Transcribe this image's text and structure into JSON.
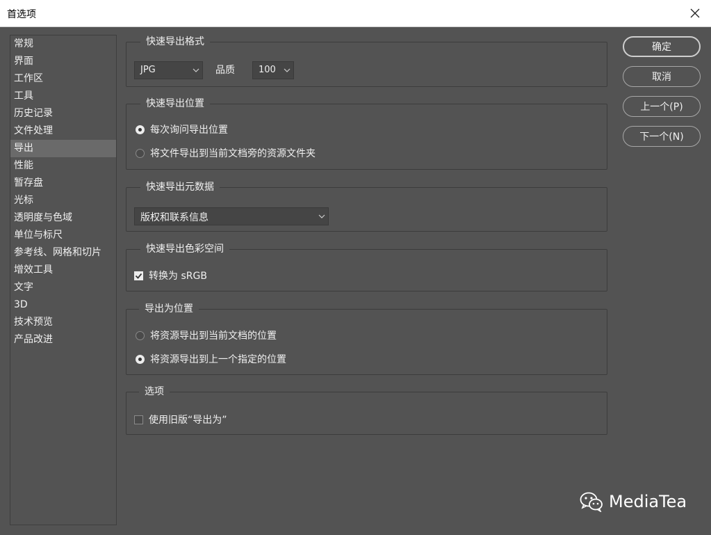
{
  "window": {
    "title": "首选项"
  },
  "sidebar": {
    "items": [
      {
        "label": "常规"
      },
      {
        "label": "界面"
      },
      {
        "label": "工作区"
      },
      {
        "label": "工具"
      },
      {
        "label": "历史记录"
      },
      {
        "label": "文件处理"
      },
      {
        "label": "导出",
        "selected": true
      },
      {
        "label": "性能"
      },
      {
        "label": "暂存盘"
      },
      {
        "label": "光标"
      },
      {
        "label": "透明度与色域"
      },
      {
        "label": "单位与标尺"
      },
      {
        "label": "参考线、网格和切片"
      },
      {
        "label": "增效工具"
      },
      {
        "label": "文字"
      },
      {
        "label": "3D"
      },
      {
        "label": "技术预览"
      },
      {
        "label": "产品改进"
      }
    ]
  },
  "quick_export_format": {
    "title": "快速导出格式",
    "format_value": "JPG",
    "quality_label": "品质",
    "quality_value": "100"
  },
  "quick_export_location": {
    "title": "快速导出位置",
    "options": [
      {
        "label": "每次询问导出位置",
        "checked": true
      },
      {
        "label": "将文件导出到当前文档旁的资源文件夹",
        "checked": false
      }
    ]
  },
  "quick_export_metadata": {
    "title": "快速导出元数据",
    "value": "版权和联系信息"
  },
  "quick_export_colorspace": {
    "title": "快速导出色彩空间",
    "checkbox_label": "转换为 sRGB",
    "checked": true
  },
  "export_as_location": {
    "title": "导出为位置",
    "options": [
      {
        "label": "将资源导出到当前文档的位置",
        "checked": false
      },
      {
        "label": "将资源导出到上一个指定的位置",
        "checked": true
      }
    ]
  },
  "options_group": {
    "title": "选项",
    "checkbox_label": "使用旧版“导出为”",
    "checked": false
  },
  "buttons": {
    "ok": "确定",
    "cancel": "取消",
    "prev": "上一个(P)",
    "next": "下一个(N)"
  },
  "watermark": {
    "text": "MediaTea",
    "icon": "wechat-icon"
  },
  "colors": {
    "background": "#535353",
    "field": "#454545",
    "border": "#3c3c3c",
    "text": "#f0f0f0"
  }
}
